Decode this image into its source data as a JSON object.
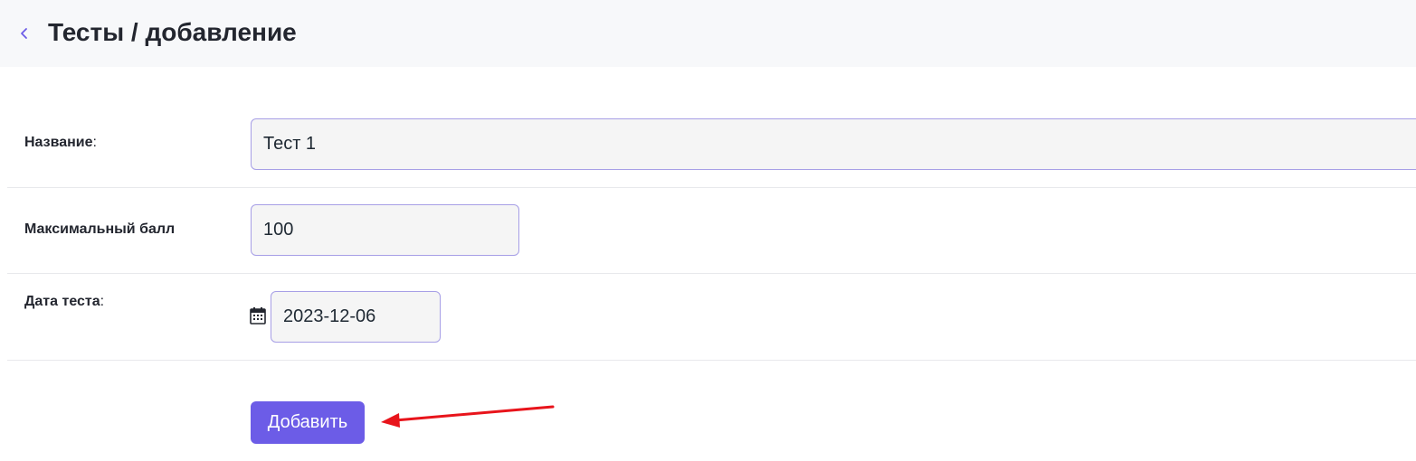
{
  "header": {
    "title": "Тесты / добавление",
    "back_icon": "chevron-left-icon"
  },
  "form": {
    "name": {
      "label": "Название",
      "suffix": ":",
      "value": "Тест 1"
    },
    "max_score": {
      "label": "Максимальный балл",
      "value": "100"
    },
    "test_date": {
      "label": "Дата теста",
      "suffix": ":",
      "value": "2023-12-06",
      "icon": "calendar-icon"
    },
    "submit_label": "Добавить"
  },
  "colors": {
    "accent": "#6c5ce7",
    "field_border": "#a79fe6",
    "annotation_arrow": "#e8141b"
  }
}
